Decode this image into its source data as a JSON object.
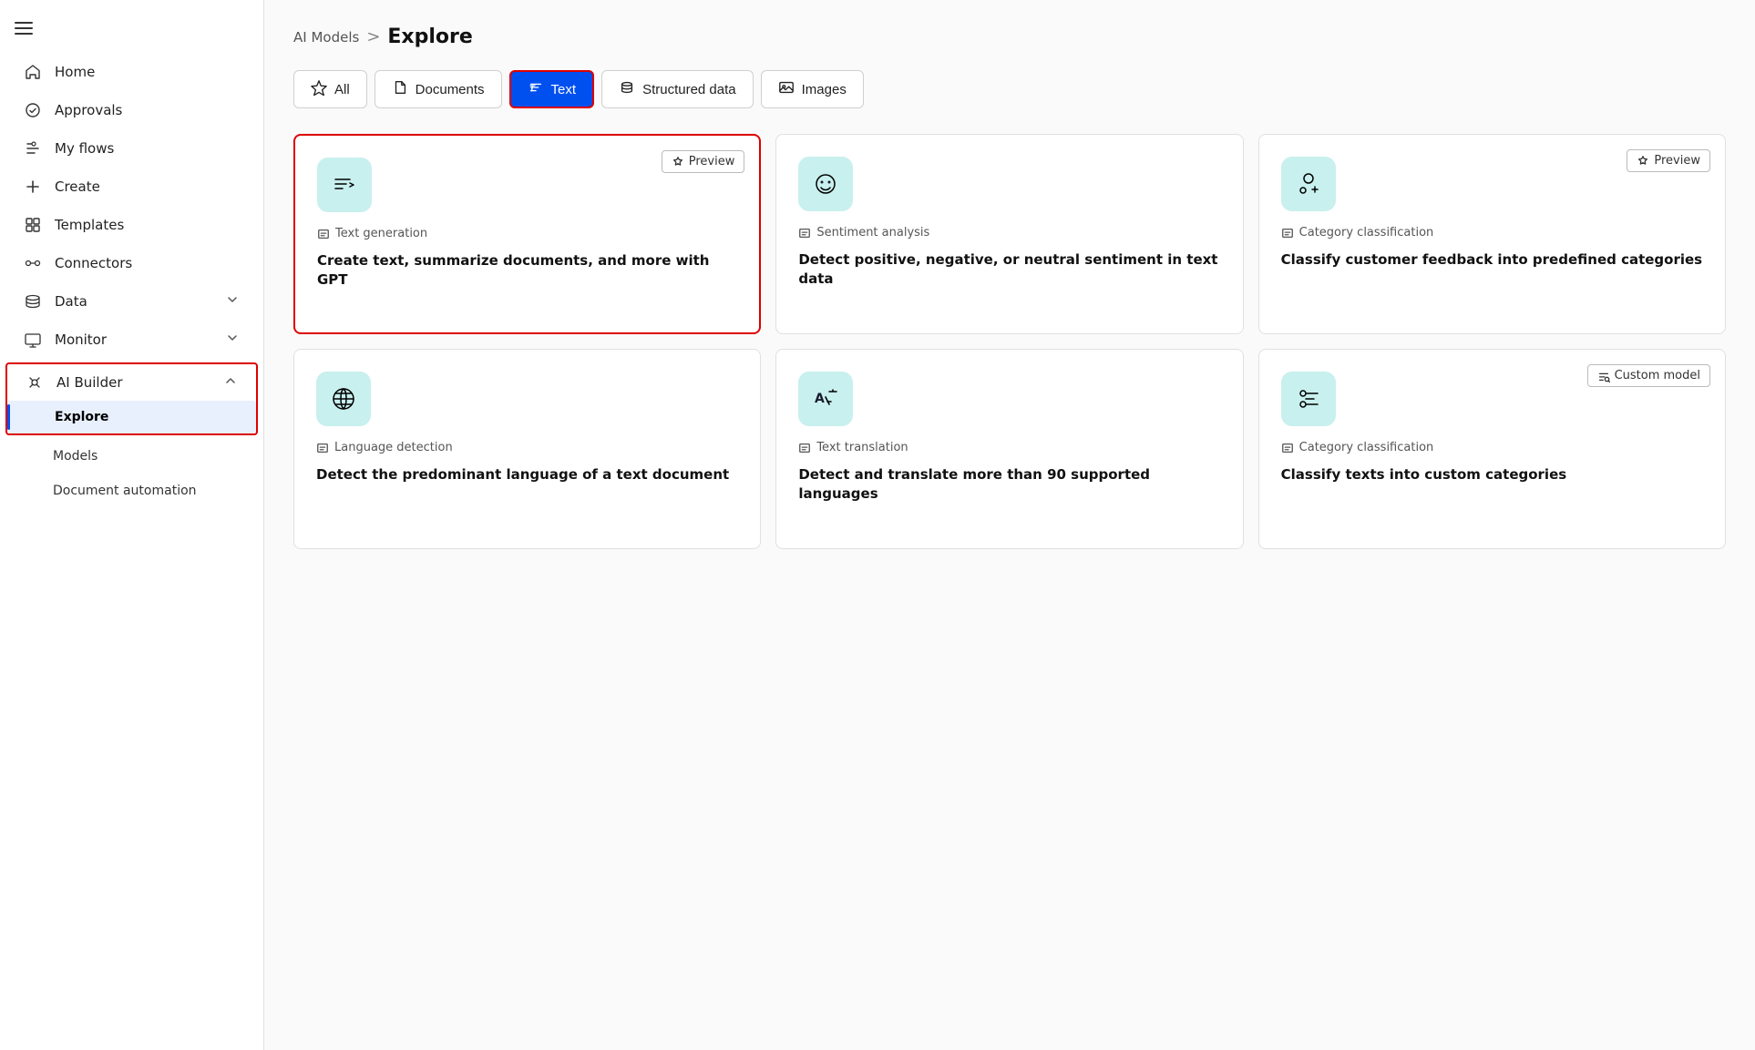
{
  "sidebar": {
    "items": [
      {
        "id": "home",
        "label": "Home",
        "icon": "home-icon"
      },
      {
        "id": "approvals",
        "label": "Approvals",
        "icon": "approvals-icon"
      },
      {
        "id": "my-flows",
        "label": "My flows",
        "icon": "flows-icon"
      },
      {
        "id": "create",
        "label": "Create",
        "icon": "create-icon"
      },
      {
        "id": "templates",
        "label": "Templates",
        "icon": "templates-icon"
      },
      {
        "id": "connectors",
        "label": "Connectors",
        "icon": "connectors-icon"
      },
      {
        "id": "data",
        "label": "Data",
        "icon": "data-icon",
        "hasChevron": true
      },
      {
        "id": "monitor",
        "label": "Monitor",
        "icon": "monitor-icon",
        "hasChevron": true
      },
      {
        "id": "ai-builder",
        "label": "AI Builder",
        "icon": "ai-builder-icon",
        "hasChevron": true,
        "expanded": true
      }
    ],
    "ai_subitems": [
      {
        "id": "explore",
        "label": "Explore",
        "active": true
      },
      {
        "id": "models",
        "label": "Models"
      },
      {
        "id": "document-automation",
        "label": "Document automation"
      }
    ]
  },
  "breadcrumb": {
    "parent": "AI Models",
    "separator": ">",
    "current": "Explore"
  },
  "filter_tabs": [
    {
      "id": "all",
      "label": "All",
      "icon": "star-icon",
      "active": false
    },
    {
      "id": "documents",
      "label": "Documents",
      "icon": "document-icon",
      "active": false
    },
    {
      "id": "text",
      "label": "Text",
      "icon": "text-icon",
      "active": true,
      "highlighted": true
    },
    {
      "id": "structured-data",
      "label": "Structured data",
      "icon": "structured-icon",
      "active": false
    },
    {
      "id": "images",
      "label": "Images",
      "icon": "images-icon",
      "active": false
    }
  ],
  "cards": [
    {
      "id": "text-generation",
      "type": "Text generation",
      "title": "Create text, summarize documents, and more with GPT",
      "badge": "Preview",
      "highlighted": true
    },
    {
      "id": "sentiment-analysis",
      "type": "Sentiment analysis",
      "title": "Detect positive, negative, or neutral sentiment in text data",
      "badge": null,
      "highlighted": false
    },
    {
      "id": "category-classification",
      "type": "Category classification",
      "title": "Classify customer feedback into predefined categories",
      "badge": "Preview",
      "highlighted": false
    },
    {
      "id": "language-detection",
      "type": "Language detection",
      "title": "Detect the predominant language of a text document",
      "badge": null,
      "highlighted": false
    },
    {
      "id": "text-translation",
      "type": "Text translation",
      "title": "Detect and translate more than 90 supported languages",
      "badge": null,
      "highlighted": false
    },
    {
      "id": "custom-category",
      "type": "Category classification",
      "title": "Classify texts into custom categories",
      "badge": "Custom model",
      "highlighted": false
    }
  ]
}
